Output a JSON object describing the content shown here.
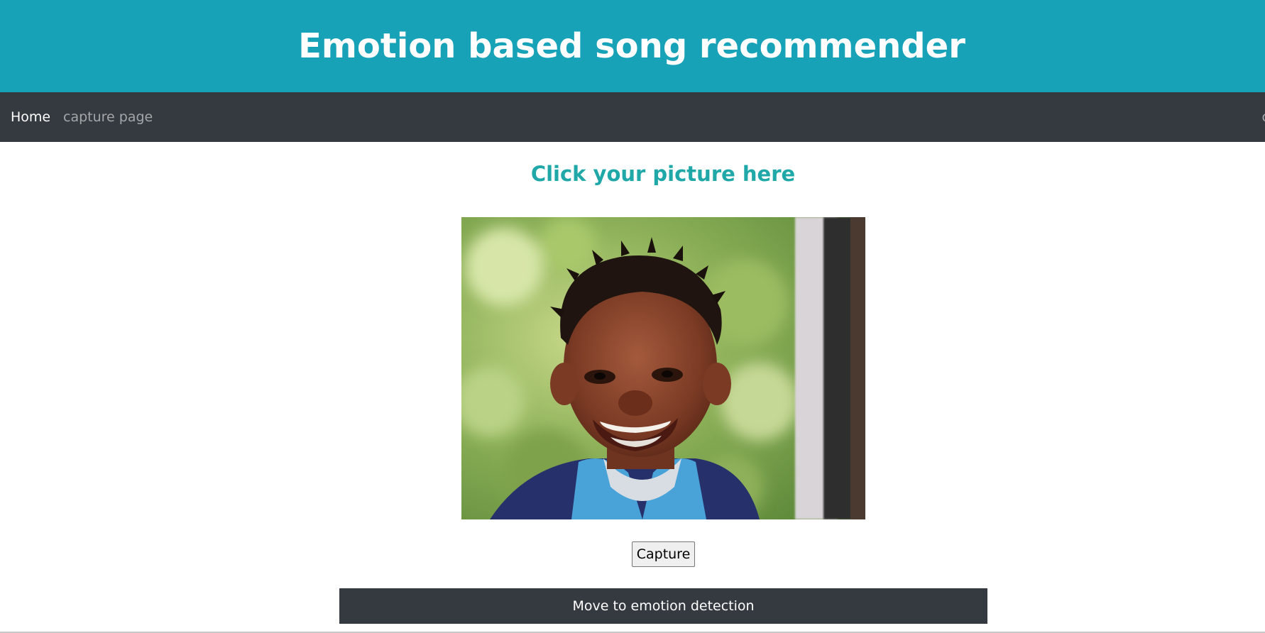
{
  "header": {
    "title": "Emotion based song recommender"
  },
  "navbar": {
    "items": [
      {
        "label": "Home",
        "active": true
      },
      {
        "label": "capture page",
        "active": false
      }
    ],
    "right_edge_text": "c"
  },
  "main": {
    "heading": "Click your picture here",
    "camera_view": {
      "content": "webcam-photo",
      "alt": "Webcam capture"
    },
    "capture_button_label": "Capture",
    "move_button_label": "Move to emotion detection"
  },
  "colors": {
    "header_bg": "#17a2b8",
    "navbar_bg": "#343a40",
    "heading_color": "#20a8a8",
    "button_dark_bg": "#343a40"
  }
}
